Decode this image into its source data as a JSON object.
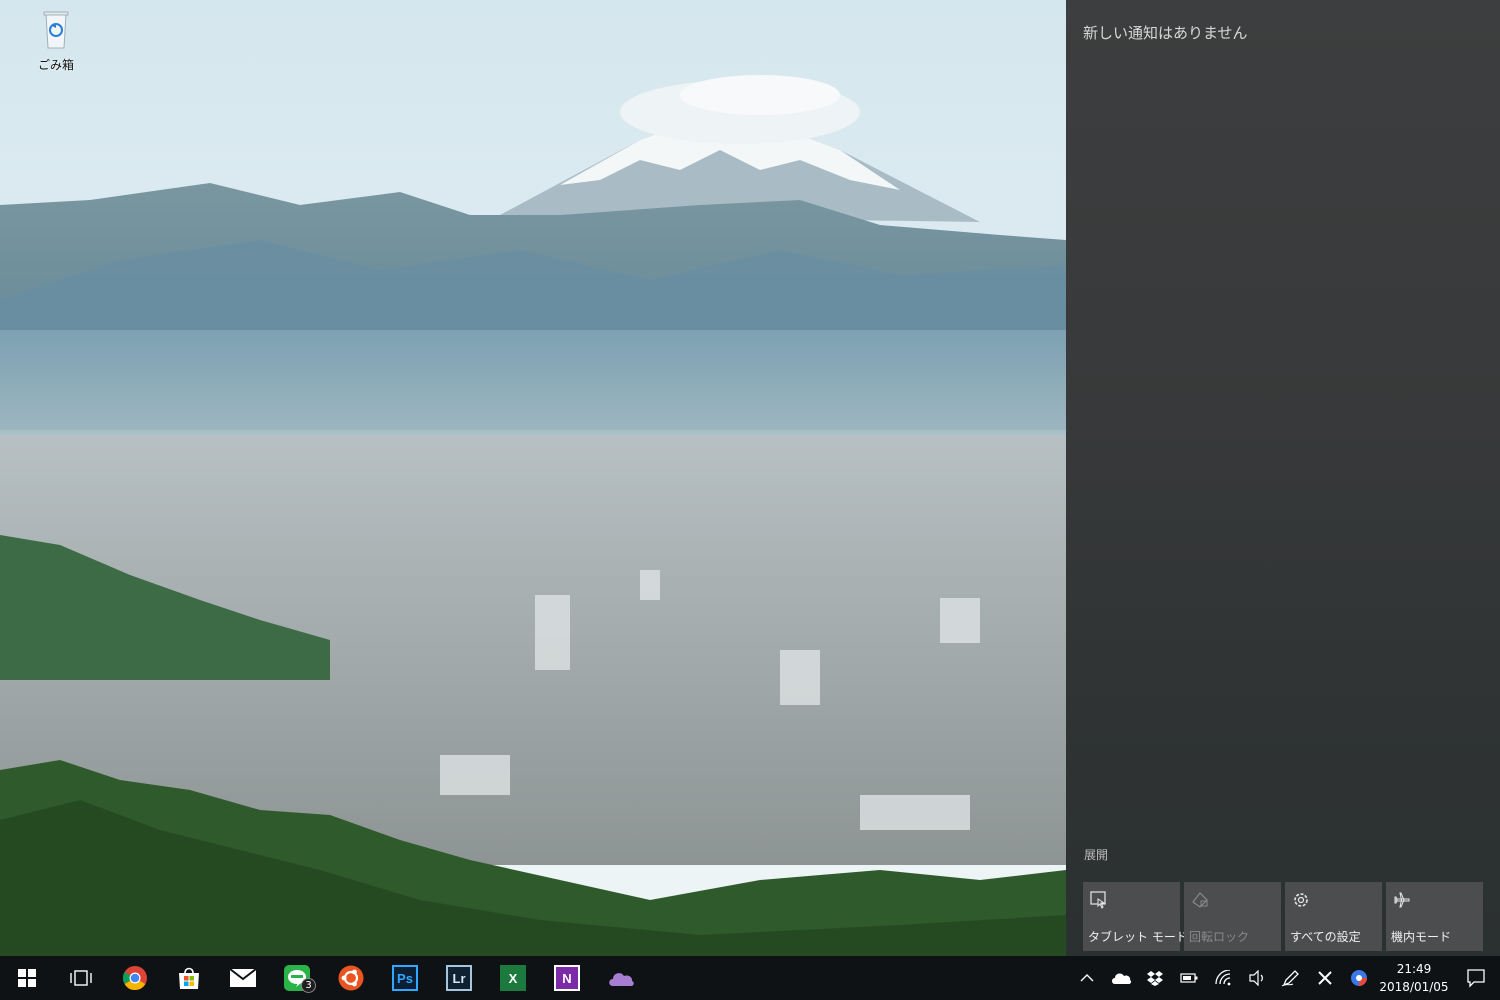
{
  "desktop": {
    "icons": [
      {
        "label": "ごみ箱",
        "icon": "recycle-bin-icon"
      }
    ]
  },
  "action_center": {
    "empty_message": "新しい通知はありません",
    "expand_label": "展開",
    "quick_actions": [
      {
        "label": "タブレット モード",
        "icon": "tablet-mode-icon",
        "enabled": true
      },
      {
        "label": "回転ロック",
        "icon": "rotation-lock-icon",
        "enabled": false
      },
      {
        "label": "すべての設定",
        "icon": "gear-icon",
        "enabled": true
      },
      {
        "label": "機内モード",
        "icon": "airplane-icon",
        "enabled": true
      }
    ]
  },
  "taskbar": {
    "pinned": [
      {
        "name": "start",
        "icon": "windows-start-icon"
      },
      {
        "name": "task-view",
        "icon": "task-view-icon"
      },
      {
        "name": "chrome",
        "icon": "chrome-icon"
      },
      {
        "name": "store",
        "icon": "store-icon"
      },
      {
        "name": "mail",
        "icon": "mail-icon"
      },
      {
        "name": "line",
        "icon": "line-icon",
        "badge": "3"
      },
      {
        "name": "ubuntu",
        "icon": "ubuntu-icon"
      },
      {
        "name": "photoshop",
        "icon": "photoshop-icon",
        "text": "Ps"
      },
      {
        "name": "lightroom",
        "icon": "lightroom-icon",
        "text": "Lr"
      },
      {
        "name": "excel",
        "icon": "excel-icon",
        "text": "X"
      },
      {
        "name": "onenote",
        "icon": "onenote-icon",
        "text": "N"
      },
      {
        "name": "onedrive",
        "icon": "onedrive-icon"
      }
    ],
    "tray_icons": [
      "chevron-up-icon",
      "cloud-icon",
      "dropbox-icon",
      "battery-icon",
      "wifi-icon",
      "volume-icon",
      "pen-icon",
      "close-x-icon",
      "color-circle-icon"
    ],
    "clock": {
      "time": "21:49",
      "date": "2018/01/05"
    }
  },
  "colors": {
    "action_center_bg": "#3a3c3d",
    "tile_bg": "#4b4d4e",
    "taskbar_bg": "#0e1214",
    "line_green": "#2bb34a",
    "excel_green": "#1d7a3e",
    "onenote_purple": "#7b2aa8",
    "photoshop_blue": "#0b1e33",
    "lightroom_blue": "#0e2231"
  }
}
